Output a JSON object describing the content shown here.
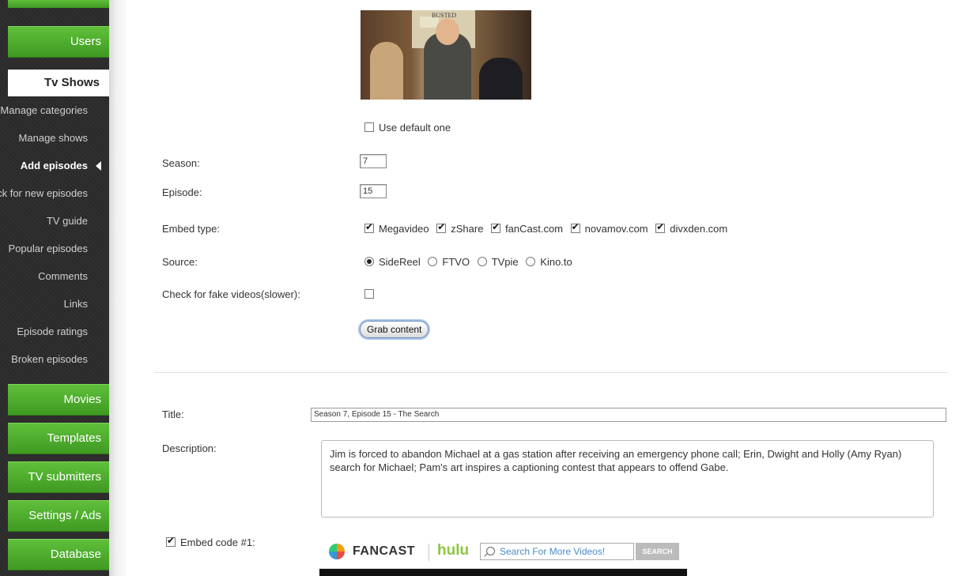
{
  "sidebar": {
    "users": "Users",
    "tv_shows": "Tv Shows",
    "items": [
      "Manage categories",
      "Manage shows",
      "Add episodes",
      "Check for new episodes",
      "TV guide",
      "Popular episodes",
      "Comments",
      "Links",
      "Episode ratings",
      "Broken episodes"
    ],
    "active_item": "Add episodes",
    "movies": "Movies",
    "templates": "Templates",
    "tv_submitters": "TV submitters",
    "settings_ads": "Settings / Ads",
    "database": "Database"
  },
  "form": {
    "thumbnail_text": "BUSTED",
    "use_default_label": "Use default one",
    "use_default_checked": false,
    "season_label": "Season:",
    "season_value": "7",
    "episode_label": "Episode:",
    "episode_value": "15",
    "embed_type_label": "Embed type:",
    "embed_types": [
      {
        "label": "Megavideo",
        "checked": true
      },
      {
        "label": "zShare",
        "checked": true
      },
      {
        "label": "fanCast.com",
        "checked": true
      },
      {
        "label": "novamov.com",
        "checked": true
      },
      {
        "label": "divxden.com",
        "checked": true
      }
    ],
    "source_label": "Source:",
    "sources": [
      {
        "label": "SideReel",
        "selected": true
      },
      {
        "label": "FTVO",
        "selected": false
      },
      {
        "label": "TVpie",
        "selected": false
      },
      {
        "label": "Kino.to",
        "selected": false
      }
    ],
    "fake_check_label": "Check for fake videos(slower):",
    "fake_check_checked": false,
    "grab_button": "Grab content"
  },
  "details": {
    "title_label": "Title:",
    "title_value": "Season 7, Episode 15 - The Search",
    "description_label": "Description:",
    "description_value": "Jim is forced to abandon Michael at a gas station after receiving an emergency phone call; Erin, Dwight and Holly (Amy Ryan) search for Michael; Pam's art inspires a captioning contest that appears to offend Gabe.",
    "embed_label": "Embed code #1:",
    "embed_checked": true
  },
  "embed_player": {
    "brand1": "FANCAST",
    "brand2": "hulu",
    "search_placeholder": "Search For More Videos!",
    "search_button": "SEARCH"
  }
}
